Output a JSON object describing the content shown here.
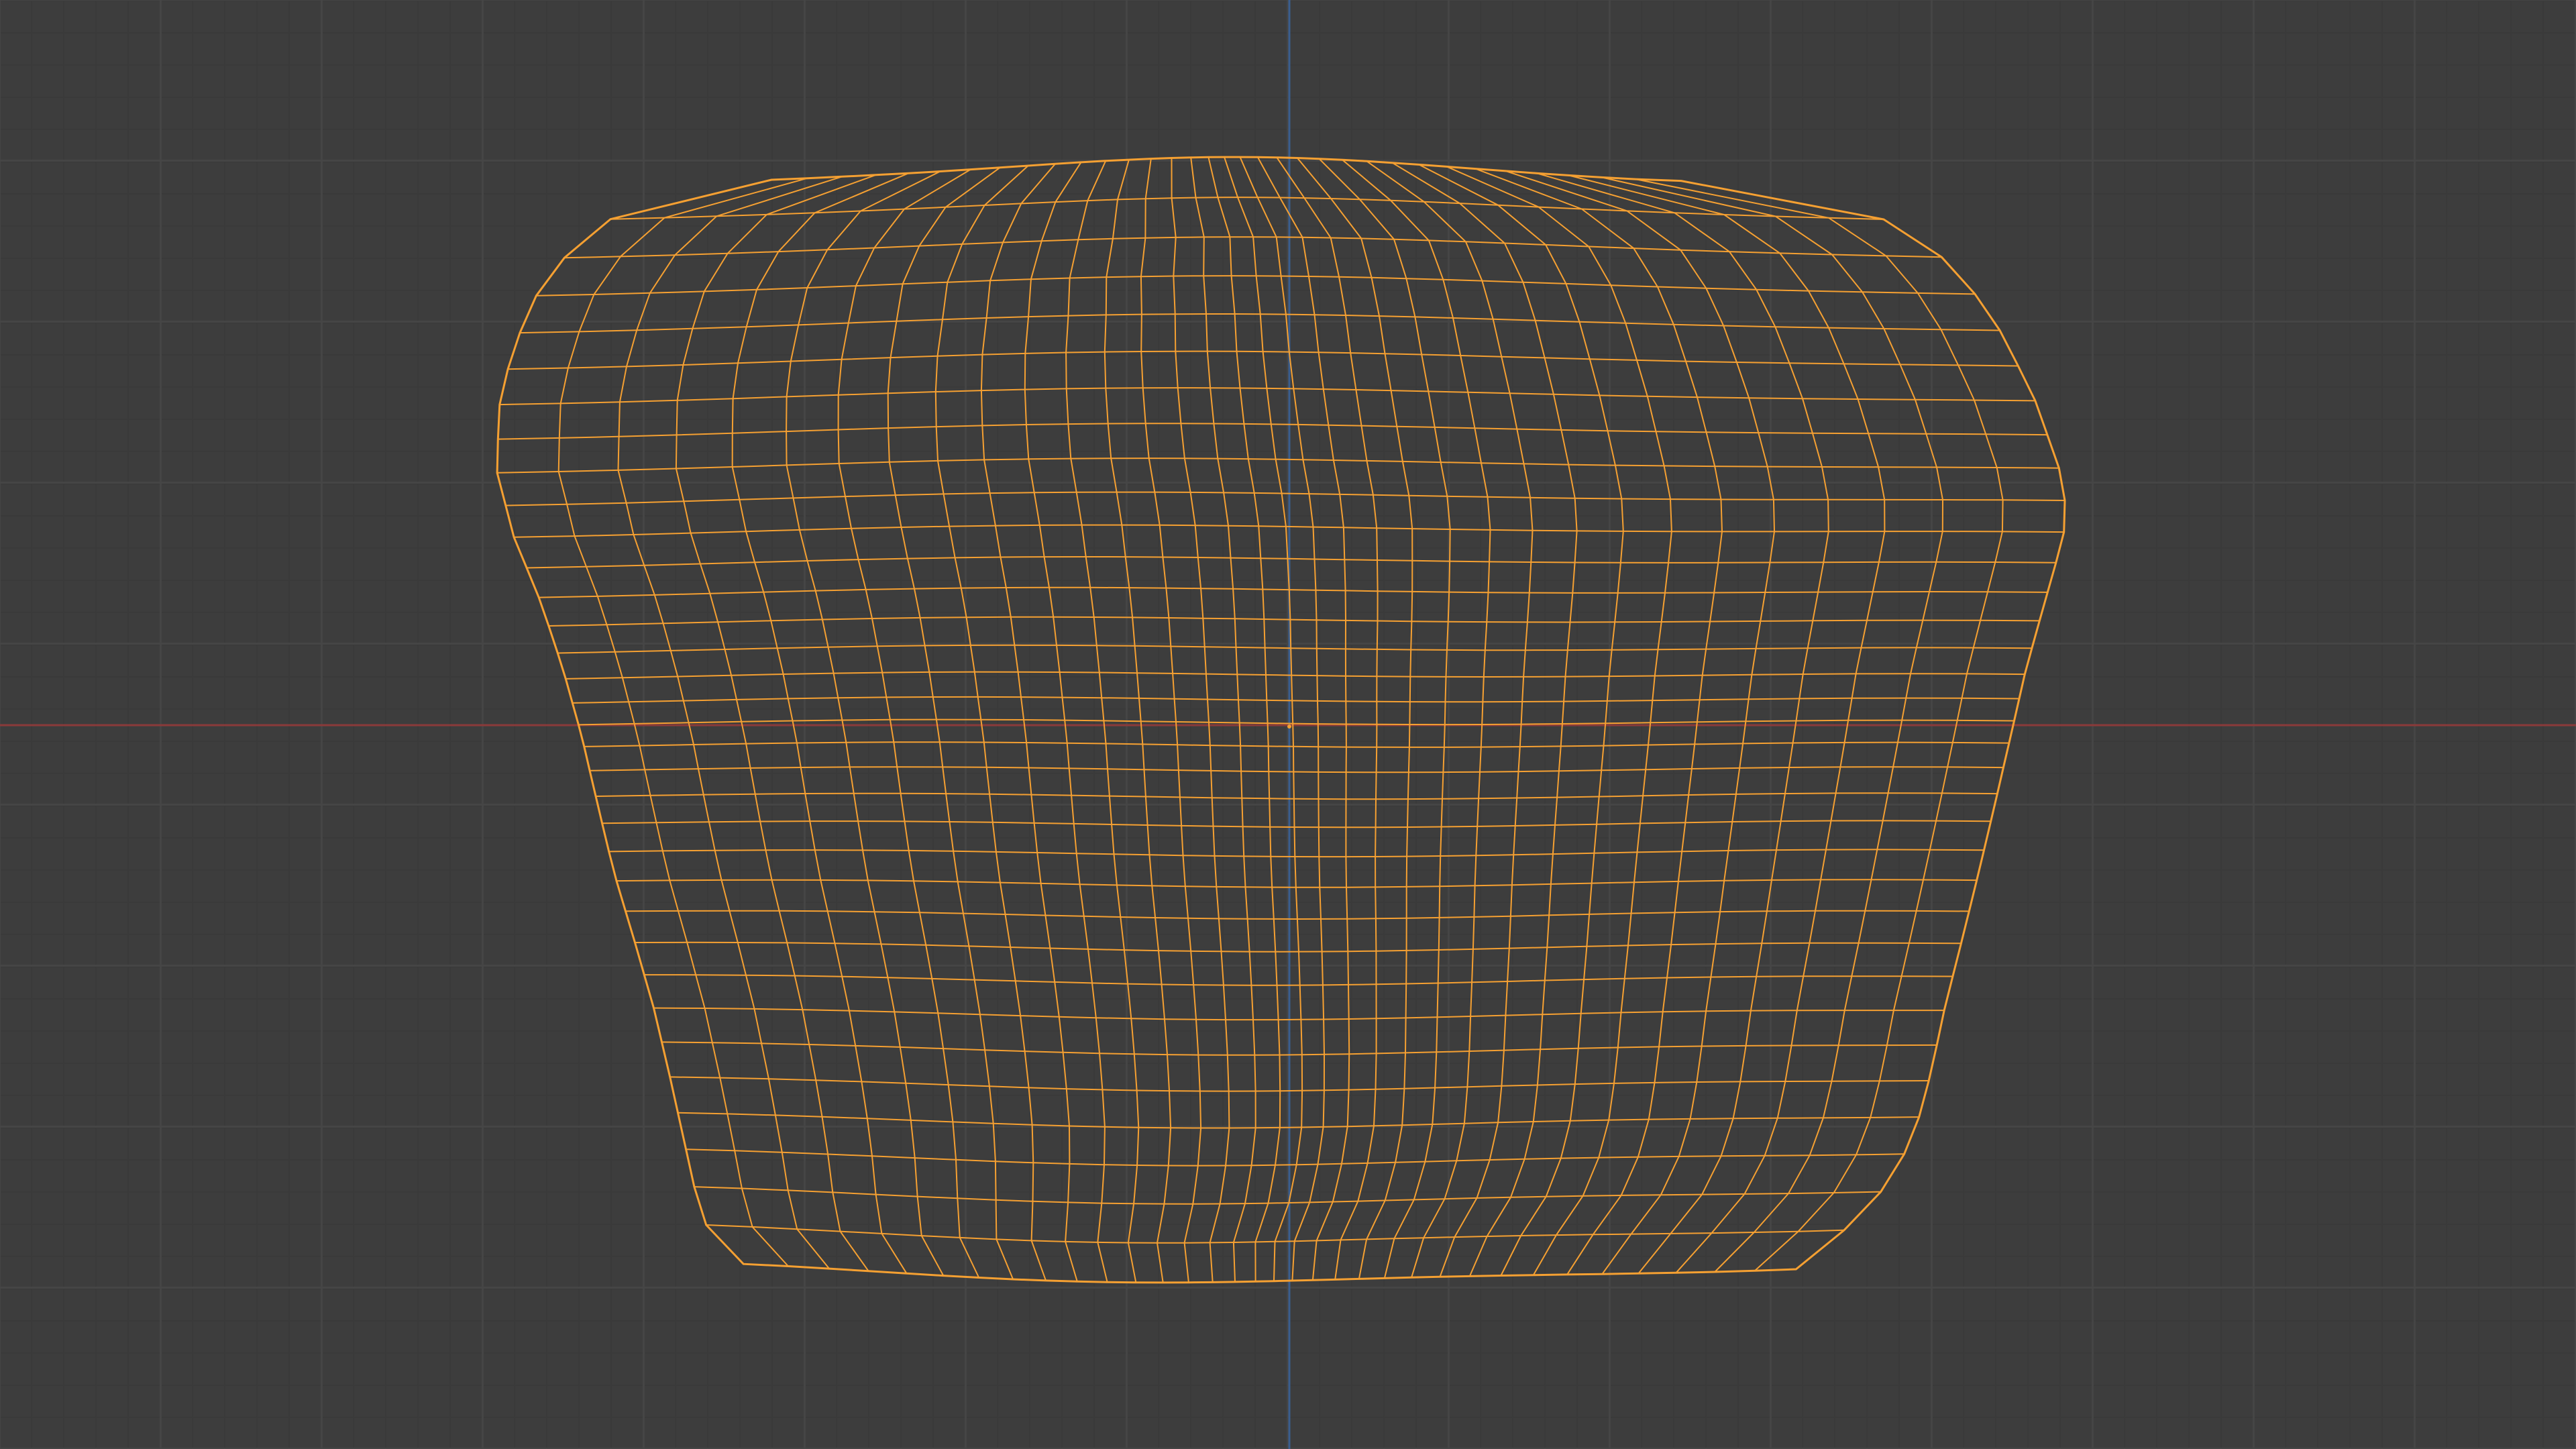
{
  "viewport": {
    "mode": "wireframe",
    "background_color": "#3d3d3d",
    "grid_minor_color": "#474747",
    "grid_major_color": "#4e4e4e"
  },
  "axes": {
    "x_axis_color": "#8a3a3a",
    "y_axis_color": "#3a5e8f"
  },
  "object": {
    "shape": "subdivided-cushion-mesh",
    "selected": true,
    "wire_color": "#f5a032",
    "origin_color": "#f5a032"
  }
}
